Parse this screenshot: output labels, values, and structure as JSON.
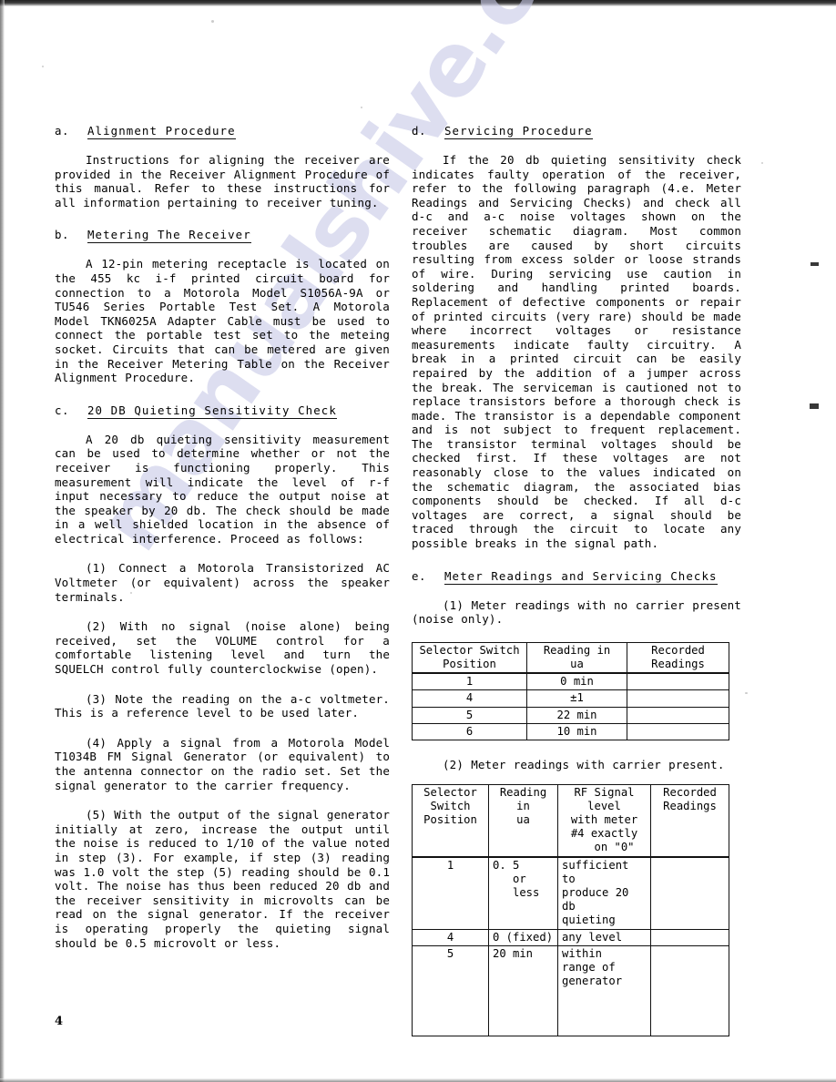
{
  "page": {
    "number": "4",
    "watermark": "manualshive.com"
  },
  "left_column": {
    "section_a": {
      "label": "a.",
      "title": "Alignment Procedure",
      "paragraphs": [
        "Instructions for aligning the receiver are provided in the Receiver Alignment Procedure of this manual. Refer to these instructions for all information pertaining to receiver tuning."
      ]
    },
    "section_b": {
      "label": "b.",
      "title": "Metering The Receiver",
      "paragraphs": [
        "A 12-pin metering receptacle is located on the 455 kc i-f printed circuit board for connection to a Motorola Model S1056A-9A or TU546 Series Portable Test Set. A Motorola Model TKN6025A Adapter Cable must be used to connect the portable test set to the meteing socket. Circuits that can be metered are given in the Receiver Metering Table on the Receiver Alignment Procedure."
      ]
    },
    "section_c": {
      "label": "c.",
      "title": "20 DB Quieting Sensitivity Check",
      "paragraphs": [
        "A 20 db quieting sensitivity measurement can be used to determine whether or not the receiver is functioning properly. This measurement will indicate the level of r-f input necessary to reduce the output noise at the speaker by 20 db. The check should be made in a well shielded location in the absence of electrical interference. Proceed as follows:"
      ],
      "steps": [
        "(1)  Connect a Motorola Transistorized AC Voltmeter (or equivalent) across the speaker terminals.",
        "(2)  With no signal (noise alone) being received, set the VOLUME control for a comfortable listening level and turn the SQUELCH control fully counterclockwise (open).",
        "(3)  Note the reading on the a-c voltmeter. This is a reference level to be used later.",
        "(4)  Apply a signal from a Motorola Model T1034B FM Signal Generator (or equivalent) to the antenna connector on the radio set. Set the signal generator to the carrier frequency.",
        "(5)  With the output of the signal generator initially at zero, increase the output until the noise is reduced to 1/10 of the value noted in step (3). For example, if step (3) reading was 1.0 volt the step (5) reading should be 0.1 volt. The noise has thus been reduced 20 db and the receiver sensitivity in microvolts can be read on the signal generator. If the receiver is operating properly the quieting signal should be 0.5 microvolt or less."
      ]
    }
  },
  "right_column": {
    "section_d": {
      "label": "d.",
      "title": "Servicing Procedure",
      "paragraphs": [
        "If the 20 db quieting sensitivity check indicates faulty operation of the receiver, refer to the following paragraph (4.e. Meter Readings and Servicing Checks) and check all d-c and a-c noise voltages shown on the receiver schematic diagram. Most common troubles are caused by short circuits resulting from excess solder or loose strands of wire. During servicing use caution in soldering and handling printed boards. Replacement of defective components or repair of printed circuits (very rare) should be made where incorrect voltages or resistance measurements indicate faulty circuitry. A break in a printed circuit can be easily repaired by the addition of a jumper across the break. The serviceman is cautioned not to replace transistors before a thorough check is made. The transistor is a dependable component and is not subject to frequent replacement. The transistor terminal voltages should be checked first. If these voltages are not reasonably close to the values indicated on the schematic diagram, the associated bias components should be checked. If all d-c voltages are correct, a signal should be traced through the circuit to locate any possible breaks in the signal path."
      ]
    },
    "section_e": {
      "label": "e.",
      "title": "Meter Readings and Servicing Checks",
      "item1_caption": "(1)  Meter readings with no carrier present (noise only).",
      "table1": {
        "headers": [
          {
            "line1": "Selector  Switch",
            "line2": "Position"
          },
          {
            "line1": "Reading in",
            "line2": "ua"
          },
          {
            "line1": "Recorded",
            "line2": "Readings"
          }
        ],
        "rows": [
          {
            "position": "1",
            "reading": "0 min",
            "recorded": ""
          },
          {
            "position": "4",
            "reading": "±1",
            "recorded": ""
          },
          {
            "position": "5",
            "reading": "22 min",
            "recorded": ""
          },
          {
            "position": "6",
            "reading": "10 min",
            "recorded": ""
          }
        ]
      },
      "item2_caption": "(2)  Meter readings with  carrier present.",
      "table2": {
        "headers": [
          {
            "line1": "Selector",
            "line2": "Switch",
            "line3": "Position",
            "line4": ""
          },
          {
            "line1": "Reading",
            "line2": "in",
            "line3": "ua",
            "line4": ""
          },
          {
            "line1": "RF Signal level",
            "line2": "with meter",
            "line3": "#4 exactly",
            "line4": "on \"0\""
          },
          {
            "line1": "Recorded",
            "line2": "Readings",
            "line3": "",
            "line4": ""
          }
        ],
        "rows": [
          {
            "position": "1",
            "reading_line1": "0. 5",
            "reading_line2": "or less",
            "rf_line1": "sufficient to",
            "rf_line2": "produce 20 db",
            "rf_line3": "quieting",
            "recorded": ""
          },
          {
            "position": "4",
            "reading_line1": "0 (fixed)",
            "reading_line2": "",
            "rf_line1": "any level",
            "rf_line2": "",
            "rf_line3": "",
            "recorded": ""
          },
          {
            "position": "5",
            "reading_line1": "20 min",
            "reading_line2": "",
            "rf_line1": "within",
            "rf_line2": "range of",
            "rf_line3": "generator",
            "recorded": ""
          }
        ]
      }
    }
  }
}
